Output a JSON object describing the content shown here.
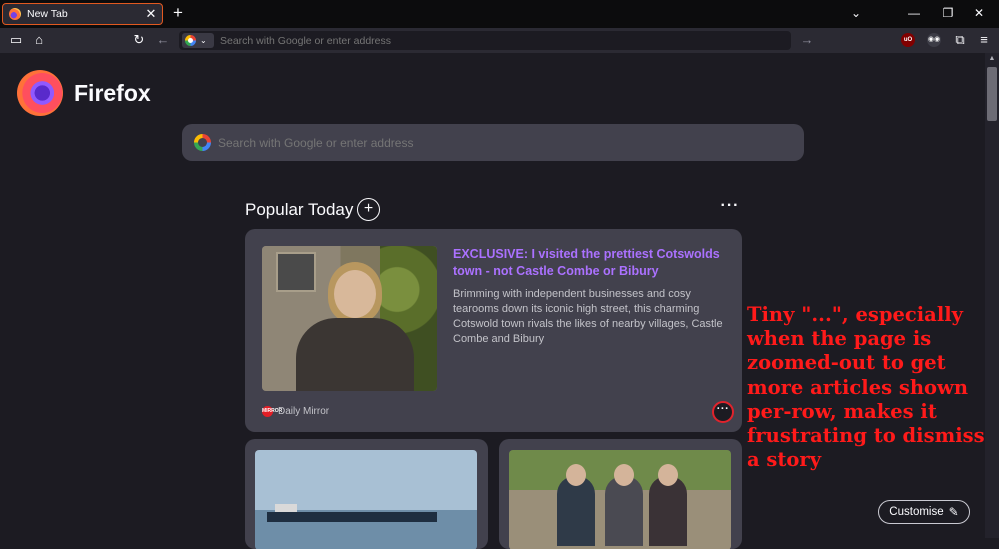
{
  "browser": {
    "tab": {
      "title": "New Tab",
      "close_glyph": "✕",
      "icon": "firefox-icon"
    },
    "new_tab_glyph": "+",
    "window_controls": {
      "list_tabs": "⌄",
      "minimize": "—",
      "restore": "❐",
      "close": "✕"
    },
    "toolbar": {
      "sidebar_icon": "▭",
      "home_icon": "⌂",
      "reload_icon": "↻",
      "back_icon": "←",
      "go_icon": "→",
      "menu_icon": "≡",
      "extensions_icon": "⧉"
    },
    "urlbar": {
      "placeholder": "Search with Google or enter address",
      "engine_icon": "google-icon",
      "engine_chevron": "⌄"
    },
    "extensions": [
      {
        "label": "uO",
        "color": "#800000"
      },
      {
        "label": "◉◉",
        "color": "#3c3c46"
      }
    ]
  },
  "newtab": {
    "brand": "Firefox",
    "search_placeholder": "Search with Google or enter address",
    "section": {
      "title": "Popular Today",
      "add_glyph": "+",
      "menu_glyph": "···"
    },
    "main_story": {
      "headline": "EXCLUSIVE: I visited the prettiest Cotswolds town - not Castle Combe or Bibury",
      "description": "Brimming with independent businesses and cosy tearooms down its iconic high street, this charming Cotswold town rivals the likes of nearby villages, Castle Combe and Bibury",
      "source": "Daily Mirror",
      "source_icon_text": "MIRROR",
      "menu_glyph": "···"
    },
    "customise": {
      "label": "Customise",
      "icon": "✎"
    }
  },
  "annotation": {
    "text": "Tiny \"...\", especially when the page is zoomed-out to get more articles shown per-row, makes it frustrating to dismiss a story",
    "color": "#ff1a1a"
  },
  "colors": {
    "accent_purple": "#ab71ff",
    "tab_border": "#e25920",
    "highlight_ring": "#e0232c"
  }
}
